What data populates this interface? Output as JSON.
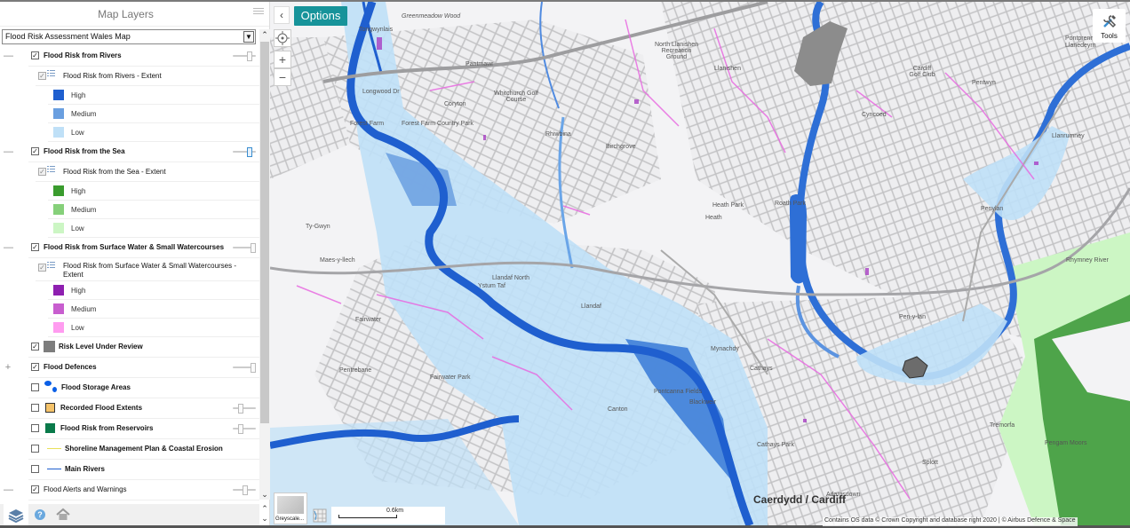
{
  "panel": {
    "title": "Map Layers",
    "map_select": "Flood Risk Assessment Wales Map"
  },
  "layers": [
    {
      "label": "Flood Risk from Rivers",
      "expanded": true,
      "checked": true,
      "opacity_pct": 75,
      "sub": {
        "label": "Flood Risk from Rivers - Extent",
        "checked": true
      },
      "legend": [
        {
          "label": "High",
          "color": "#1f5fcf"
        },
        {
          "label": "Medium",
          "color": "#6a9fe0"
        },
        {
          "label": "Low",
          "color": "#bfe0f7"
        }
      ]
    },
    {
      "label": "Flood Risk from the Sea",
      "expanded": true,
      "checked": true,
      "opacity_pct": 75,
      "sub": {
        "label": "Flood Risk from the Sea - Extent",
        "checked": true
      },
      "legend": [
        {
          "label": "High",
          "color": "#3a9c2e"
        },
        {
          "label": "Medium",
          "color": "#86d07a"
        },
        {
          "label": "Low",
          "color": "#ccf6c4"
        }
      ]
    },
    {
      "label": "Flood Risk from Surface Water & Small Watercourses",
      "expanded": true,
      "checked": true,
      "opacity_pct": 100,
      "sub": {
        "label": "Flood Risk from Surface Water & Small Watercourses - Extent",
        "checked": true
      },
      "legend": [
        {
          "label": "High",
          "color": "#8e1fb0"
        },
        {
          "label": "Medium",
          "color": "#c85ecf"
        },
        {
          "label": "Low",
          "color": "#ff9cf0"
        }
      ]
    },
    {
      "label": "Risk Level Under Review",
      "checked": true,
      "swatch": "#7d7d7d"
    },
    {
      "label": "Flood Defences",
      "collapsed": true,
      "checked": true,
      "opacity_pct": 100
    },
    {
      "label": "Flood Storage Areas",
      "checked": false,
      "icon": "flood-storage"
    },
    {
      "label": "Recorded Flood Extents",
      "checked": false,
      "swatch": "#f5c36a",
      "opacity_pct": 20
    },
    {
      "label": "Flood Risk from Reservoirs",
      "checked": false,
      "swatch": "#0a7a4a",
      "opacity_pct": 20
    },
    {
      "label": "Shoreline Management Plan & Coastal Erosion",
      "checked": false,
      "line": "#e8e05a"
    },
    {
      "label": "Main Rivers",
      "checked": false,
      "line": "#1f5fcf"
    },
    {
      "label": "Flood Alerts and Warnings",
      "expanded": true,
      "checked": true,
      "opacity_pct": 45
    }
  ],
  "footer": {
    "tabs": [
      {
        "name": "layers-icon"
      },
      {
        "name": "help-icon"
      },
      {
        "name": "home-icon"
      }
    ]
  },
  "map": {
    "options_label": "Options",
    "collapse_glyph": "‹",
    "zoom_in": "+",
    "zoom_out": "−",
    "tools_label": "Tools",
    "basemap_label": "Greyscale...",
    "scale_label": "0.6km",
    "attribution": "Contains OS data © Crown Copyright and database right 2020 | © Airbus Defence & Space",
    "labels": [
      {
        "text": "Greenmeadow Wood",
        "italic": true
      },
      {
        "text": "Tongwynlais"
      },
      {
        "text": "Pantmawr"
      },
      {
        "text": "Whitchurch Golf Course"
      },
      {
        "text": "Coryton"
      },
      {
        "text": "Longwood Dr"
      },
      {
        "text": "Forest Farm"
      },
      {
        "text": "Forest Farm Country Park"
      },
      {
        "text": "Rhiwbina"
      },
      {
        "text": "North Llanishen Recreation Ground"
      },
      {
        "text": "Llanishen"
      },
      {
        "text": "Cardiff Golf Club"
      },
      {
        "text": "Cyncoed"
      },
      {
        "text": "Pentwyn"
      },
      {
        "text": "Pontprennau"
      },
      {
        "text": "Llanedeyrn"
      },
      {
        "text": "Llanrumney"
      },
      {
        "text": "Birchgrove"
      },
      {
        "text": "Heath Park"
      },
      {
        "text": "Heath"
      },
      {
        "text": "Roath Park"
      },
      {
        "text": "Ty-Gwyn"
      },
      {
        "text": "Maes-y-llech"
      },
      {
        "text": "Llandaf North"
      },
      {
        "text": "Ystum Taf"
      },
      {
        "text": "Llandaf"
      },
      {
        "text": "Fairwater"
      },
      {
        "text": "Fairwater Park"
      },
      {
        "text": "Pentrebane"
      },
      {
        "text": "Pen-y-lan"
      },
      {
        "text": "Penylan"
      },
      {
        "text": "Rhymney River"
      },
      {
        "text": "Cathays"
      },
      {
        "text": "Cathays Park"
      },
      {
        "text": "Blackweir"
      },
      {
        "text": "Pontcanna Fields"
      },
      {
        "text": "Mynachdy"
      },
      {
        "text": "Canton"
      },
      {
        "text": "Tremorfa"
      },
      {
        "text": "Splott"
      },
      {
        "text": "Adamsdown"
      },
      {
        "text": "Pengam Moors"
      },
      {
        "text": "Caerdydd / Cardiff",
        "big": true
      }
    ]
  }
}
